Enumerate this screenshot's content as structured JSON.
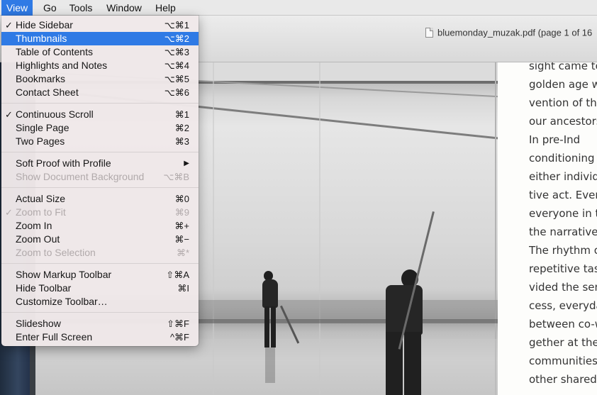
{
  "menubar": {
    "items": [
      "View",
      "Go",
      "Tools",
      "Window",
      "Help"
    ],
    "active": "View"
  },
  "window": {
    "title": "bluemonday_muzak.pdf (page 1 of 16"
  },
  "view_menu": {
    "groups": [
      [
        {
          "label": "Hide Sidebar",
          "shortcut": "⌥⌘1",
          "checked": true
        },
        {
          "label": "Thumbnails",
          "shortcut": "⌥⌘2",
          "highlighted": true
        },
        {
          "label": "Table of Contents",
          "shortcut": "⌥⌘3"
        },
        {
          "label": "Highlights and Notes",
          "shortcut": "⌥⌘4"
        },
        {
          "label": "Bookmarks",
          "shortcut": "⌥⌘5"
        },
        {
          "label": "Contact Sheet",
          "shortcut": "⌥⌘6"
        }
      ],
      [
        {
          "label": "Continuous Scroll",
          "shortcut": "⌘1",
          "checked": true
        },
        {
          "label": "Single Page",
          "shortcut": "⌘2"
        },
        {
          "label": "Two Pages",
          "shortcut": "⌘3"
        }
      ],
      [
        {
          "label": "Soft Proof with Profile",
          "submenu": true
        },
        {
          "label": "Show Document Background",
          "shortcut": "⌥⌘B",
          "disabled": true
        }
      ],
      [
        {
          "label": "Actual Size",
          "shortcut": "⌘0"
        },
        {
          "label": "Zoom to Fit",
          "shortcut": "⌘9",
          "checked": true,
          "disabled": true
        },
        {
          "label": "Zoom In",
          "shortcut": "⌘+"
        },
        {
          "label": "Zoom Out",
          "shortcut": "⌘−"
        },
        {
          "label": "Zoom to Selection",
          "shortcut": "⌘*",
          "disabled": true
        }
      ],
      [
        {
          "label": "Show Markup Toolbar",
          "shortcut": "⇧⌘A"
        },
        {
          "label": "Hide Toolbar",
          "shortcut": "⌘I"
        },
        {
          "label": "Customize Toolbar…"
        }
      ],
      [
        {
          "label": "Slideshow",
          "shortcut": "⇧⌘F"
        },
        {
          "label": "Enter Full Screen",
          "shortcut": "^⌘F"
        }
      ]
    ],
    "check_glyph": "✓",
    "submenu_glyph": "▶"
  },
  "page_text": {
    "lines": [
      "sight came to",
      "golden age w",
      "vention of the",
      "our ancestors",
      "    In pre-Ind",
      "conditioning o",
      "either individu",
      "tive act. Even",
      "everyone in th",
      "the narrative,",
      "The rhythm o",
      "repetitive task",
      "vided the sen",
      "cess, everyday",
      "between co-w",
      "gether at the",
      "communities h",
      "other shared"
    ]
  },
  "colors": {
    "menu_highlight": "#2f7ae5",
    "menu_background": "#f0e8e9",
    "menubar_background": "#e9e9e9"
  },
  "icons": {
    "document": "pdf-document-icon"
  }
}
